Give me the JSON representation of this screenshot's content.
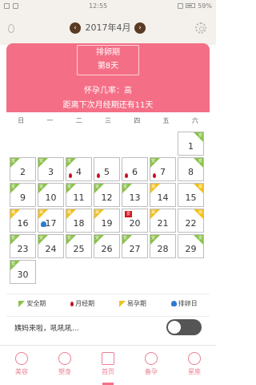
{
  "status_bar": {
    "time": "12:55",
    "battery": "59%"
  },
  "header": {
    "month": "2017年4月",
    "prev": "‹",
    "next": "›"
  },
  "cycle_card": {
    "phase": "排卵期",
    "day": "第8天",
    "chance": "怀孕几率：高",
    "countdown": "距离下次月经期还有11天"
  },
  "calendar": {
    "weekdays": [
      "日",
      "一",
      "二",
      "三",
      "四",
      "五",
      "六"
    ],
    "tag_labels": {
      "safe": "安",
      "fertile": "易"
    },
    "heart_label": "爱",
    "days": [
      {
        "d": "1",
        "tag": "safe-right"
      },
      {
        "d": "2",
        "tag": "safe-left"
      },
      {
        "d": "3",
        "tag": "safe-left"
      },
      {
        "d": "4",
        "tag": "safe-left",
        "mark": "period"
      },
      {
        "d": "5",
        "mark": "period"
      },
      {
        "d": "6",
        "mark": "period"
      },
      {
        "d": "7",
        "tag": "safe-left",
        "mark": "period"
      },
      {
        "d": "8",
        "tag": "safe-right"
      },
      {
        "d": "9",
        "tag": "safe-left"
      },
      {
        "d": "10",
        "tag": "safe-left"
      },
      {
        "d": "11",
        "tag": "safe-left"
      },
      {
        "d": "12",
        "tag": "safe-left"
      },
      {
        "d": "13",
        "tag": "safe-left"
      },
      {
        "d": "14",
        "tag": "fertile-left"
      },
      {
        "d": "15",
        "tag": "fertile-right"
      },
      {
        "d": "16",
        "tag": "fertile-left"
      },
      {
        "d": "17",
        "tag": "fertile-left",
        "mark": "ovulation"
      },
      {
        "d": "18",
        "tag": "fertile-left"
      },
      {
        "d": "19",
        "tag": "fertile-left"
      },
      {
        "d": "20",
        "mark": "heart"
      },
      {
        "d": "21",
        "tag": "fertile-left"
      },
      {
        "d": "22",
        "tag": "fertile-right"
      },
      {
        "d": "23",
        "tag": "safe-left"
      },
      {
        "d": "24",
        "tag": "safe-left"
      },
      {
        "d": "25",
        "tag": "safe-left"
      },
      {
        "d": "26",
        "tag": "safe-left"
      },
      {
        "d": "27",
        "tag": "safe-left"
      },
      {
        "d": "28",
        "tag": "safe-left"
      },
      {
        "d": "29",
        "tag": "safe-right"
      },
      {
        "d": "30",
        "tag": "safe-left"
      }
    ]
  },
  "legend": {
    "safe": "安全期",
    "period": "月经期",
    "fertile": "易孕期",
    "ovulation": "排卵日"
  },
  "reminder": {
    "text": "姨妈来啦，吼吼吼...",
    "toggle_on": false
  },
  "bottom_nav": [
    {
      "label": "美容",
      "icon": "face-icon"
    },
    {
      "label": "塑身",
      "icon": "body-icon"
    },
    {
      "label": "首页",
      "icon": "home-icon",
      "active": true
    },
    {
      "label": "备孕",
      "icon": "pregnancy-icon"
    },
    {
      "label": "星座",
      "icon": "star-icon"
    }
  ],
  "colors": {
    "accent": "#f46f86",
    "safe": "#8bc34a",
    "fertile": "#f2c11e",
    "period": "#c3121e",
    "ovulation": "#2e7bd1"
  }
}
